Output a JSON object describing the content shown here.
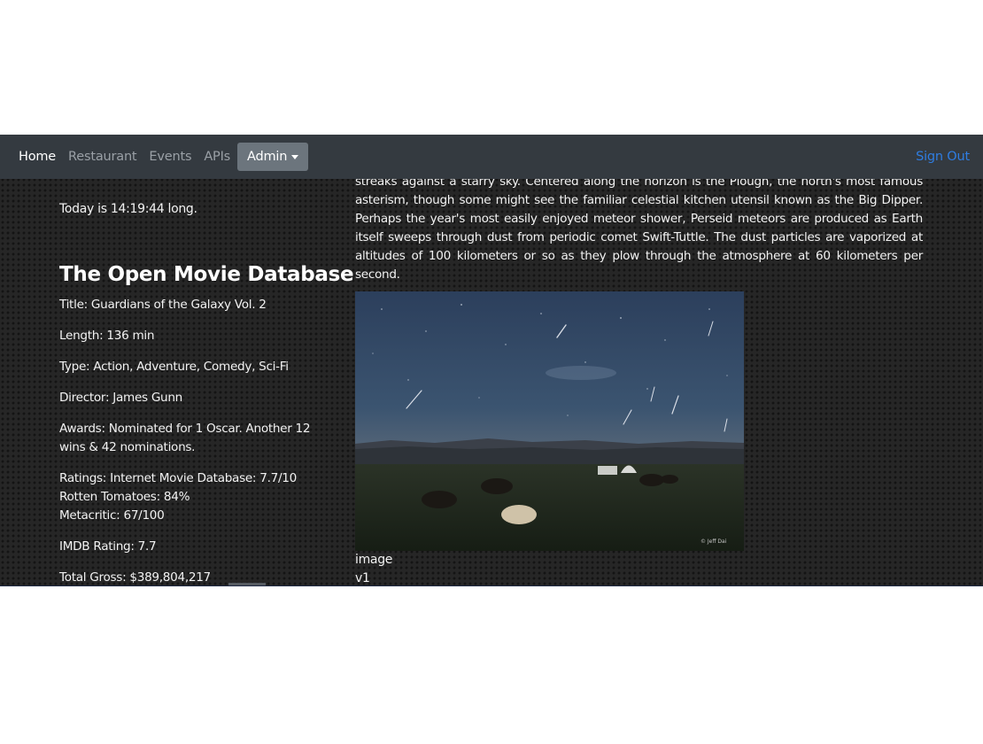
{
  "nav": {
    "items": [
      {
        "label": "Home"
      },
      {
        "label": "Restaurant"
      },
      {
        "label": "Events"
      },
      {
        "label": "APIs"
      }
    ],
    "admin_label": "Admin",
    "signout_label": "Sign Out"
  },
  "today_text": "Today is 14:19:44 long.",
  "omdb": {
    "heading": "The Open Movie Database",
    "title": "Title: Guardians of the Galaxy Vol. 2",
    "length": "Length: 136 min",
    "type": "Type: Action, Adventure, Comedy, Sci-Fi",
    "director": "Director: James Gunn",
    "awards": "Awards: Nominated for 1 Oscar. Another 12 wins & 42 nominations.",
    "ratings": [
      "Ratings: Internet Movie Database: 7.7/10",
      "Rotten Tomatoes: 84%",
      "Metacritic: 67/100"
    ],
    "imdb_rating": "IMDB Rating: 7.7",
    "total_gross": "Total Gross: $389,804,217"
  },
  "apod": {
    "explanation": "streaks against a starry sky. Centered along the horizon is the Plough, the north's most famous asterism, though some might see the familiar celestial kitchen utensil known as the Big Dipper. Perhaps the year's most easily enjoyed meteor shower, Perseid meteors are produced as Earth itself sweeps through dust from periodic comet Swift-Tuttle. The dust particles are vaporized at altitudes of 100 kilometers or so as they plow through the atmosphere at 60 kilometers per second.",
    "photo_watermark": "© Jeff Dai",
    "media_type": "image",
    "service_version": "v1"
  },
  "colors": {
    "navbar": "#343a40",
    "admin_button": "#6c757d",
    "signout_link": "#2f7de1",
    "page_background": "#262626"
  }
}
